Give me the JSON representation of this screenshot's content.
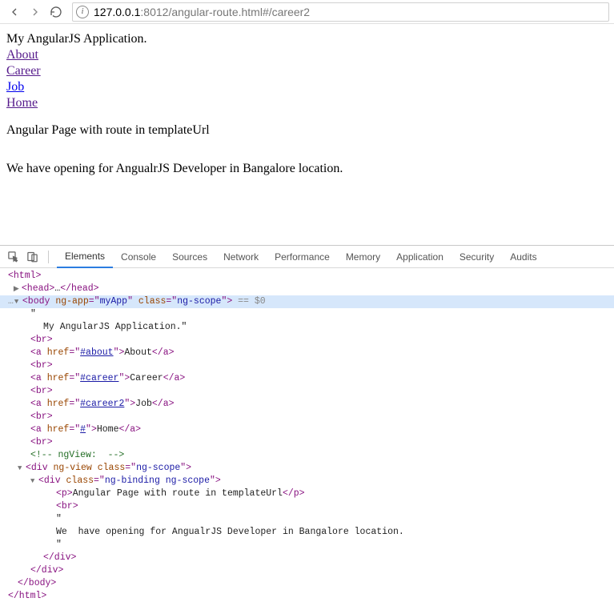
{
  "toolbar": {
    "back_label": "Back",
    "forward_label": "Forward",
    "reload_label": "Reload",
    "url_host": "127.0.0.1",
    "url_port": ":8012",
    "url_path": "/angular-route.html#/career2"
  },
  "page": {
    "heading": "My AngularJS Application.",
    "links": {
      "about": "About",
      "career": "Career",
      "job": "Job",
      "home": "Home"
    },
    "view": {
      "para1": "Angular Page with route in templateUrl",
      "para2": "We have opening for AngualrJS Developer in Bangalore location."
    }
  },
  "devtools": {
    "tabs": {
      "elements": "Elements",
      "console": "Console",
      "sources": "Sources",
      "network": "Network",
      "performance": "Performance",
      "memory": "Memory",
      "application": "Application",
      "security": "Security",
      "audits": "Audits"
    },
    "src": {
      "html_open": "<html>",
      "head": "<head>…</head>",
      "body_open_prefix": "<body ",
      "body_attr_ngapp_name": "ng-app",
      "body_attr_ngapp_val": "myApp",
      "body_attr_class_name": "class",
      "body_attr_class_val": "ng-scope",
      "sel_tail": " == $0",
      "quote": "\"",
      "text_heading": "My AngularJS Application.\"",
      "br": "<br>",
      "a_open": "<a ",
      "href_name": "href",
      "href_about": "#about",
      "link_about_text": "About",
      "href_career": "#career",
      "link_career_text": "Career",
      "href_career2": "#career2",
      "link_job_text": "Job",
      "href_home": "#",
      "link_home_text": "Home",
      "a_close": "</a>",
      "comment_ngview": "<!-- ngView:  -->",
      "div_open": "<div ",
      "ngview_attr": "ng-view",
      "class_attr": "class",
      "class_ngscope": "ng-scope",
      "class_binding": "ng-binding ng-scope",
      "p_open": "<p>",
      "p_text": "Angular Page with route in templateUrl",
      "p_close": "</p>",
      "inner_text": "We  have opening for AngualrJS Developer in Bangalore location.",
      "div_close": "</div>",
      "body_close": "</body>",
      "html_close": "</html>"
    }
  }
}
